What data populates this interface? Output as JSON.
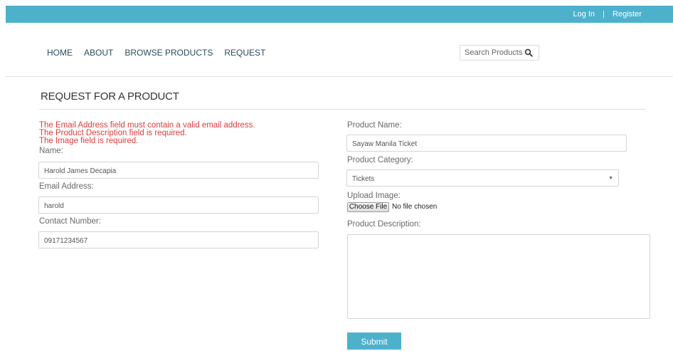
{
  "topbar": {
    "login": "Log In",
    "separator": "|",
    "register": "Register"
  },
  "nav": {
    "items": [
      "HOME",
      "ABOUT",
      "BROWSE PRODUCTS",
      "REQUEST"
    ]
  },
  "search": {
    "placeholder": "Search Products",
    "icon": "search-icon"
  },
  "page": {
    "title": "REQUEST FOR A PRODUCT"
  },
  "errors": [
    "The Email Address field must contain a valid email address.",
    "The Product Description field is required.",
    "The Image field is required."
  ],
  "form": {
    "name_label": "Name:",
    "name_value": "Harold James Decapia",
    "email_label": "Email Address:",
    "email_value": "harold",
    "contact_label": "Contact Number:",
    "contact_value": "09171234567",
    "product_name_label": "Product Name:",
    "product_name_value": "Sayaw Manila Ticket",
    "category_label": "Product Category:",
    "category_value": "Tickets",
    "upload_label": "Upload Image:",
    "choose_file": "Choose File",
    "no_file": "No file chosen",
    "description_label": "Product Description:",
    "description_value": "",
    "submit": "Submit"
  },
  "colors": {
    "accent": "#4db1cc",
    "error": "#e03b3b",
    "nav_text": "#2b4c5c"
  }
}
